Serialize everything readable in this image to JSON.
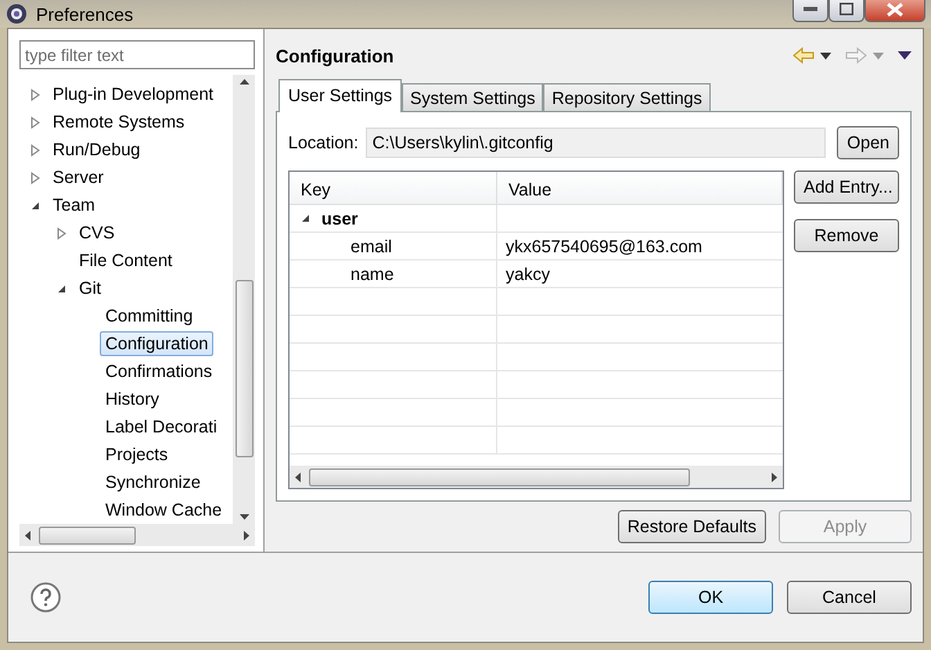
{
  "window": {
    "title": "Preferences"
  },
  "filter": {
    "placeholder": "type filter text"
  },
  "tree": [
    {
      "label": "Plug-in Development",
      "expanded": false,
      "selected": false
    },
    {
      "label": "Remote Systems",
      "expanded": false,
      "selected": false
    },
    {
      "label": "Run/Debug",
      "expanded": false,
      "selected": false
    },
    {
      "label": "Server",
      "expanded": false,
      "selected": false
    },
    {
      "label": "Team",
      "expanded": true,
      "selected": false,
      "children": [
        {
          "label": "CVS",
          "expanded": false,
          "selected": false
        },
        {
          "label": "File Content",
          "selected": false
        },
        {
          "label": "Git",
          "expanded": true,
          "selected": false,
          "children": [
            {
              "label": "Committing",
              "selected": false
            },
            {
              "label": "Configuration",
              "selected": true
            },
            {
              "label": "Confirmations",
              "selected": false
            },
            {
              "label": "History",
              "selected": false
            },
            {
              "label": "Label Decorati",
              "selected": false
            },
            {
              "label": "Projects",
              "selected": false
            },
            {
              "label": "Synchronize",
              "selected": false
            },
            {
              "label": "Window Cache",
              "selected": false
            }
          ]
        }
      ]
    }
  ],
  "page": {
    "title": "Configuration"
  },
  "tabs": [
    {
      "label": "User Settings",
      "selected": true
    },
    {
      "label": "System Settings",
      "selected": false
    },
    {
      "label": "Repository Settings",
      "selected": false
    }
  ],
  "location": {
    "label": "Location:",
    "value": "C:\\Users\\kylin\\.gitconfig",
    "button": "Open"
  },
  "table": {
    "columns": [
      "Key",
      "Value"
    ],
    "rows": [
      {
        "key": "user",
        "expanded": true,
        "children": [
          {
            "key": "email",
            "value": "ykx657540695@163.com"
          },
          {
            "key": "name",
            "value": "yakcy"
          }
        ]
      }
    ]
  },
  "side_buttons": [
    {
      "label": "Add Entry...",
      "disabled": false
    },
    {
      "label": "Remove",
      "disabled": false
    }
  ],
  "page_buttons": [
    {
      "label": "Restore Defaults",
      "disabled": false
    },
    {
      "label": "Apply",
      "disabled": true
    }
  ],
  "dialog_buttons": [
    {
      "label": "OK",
      "default": true
    },
    {
      "label": "Cancel",
      "default": false
    }
  ]
}
